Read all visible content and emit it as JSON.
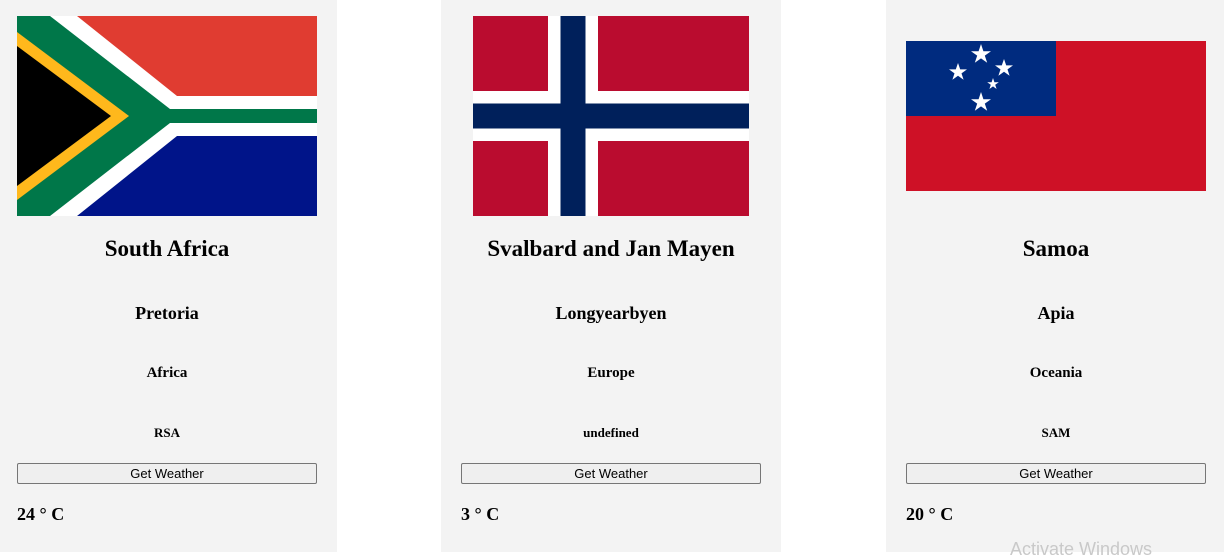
{
  "countries": [
    {
      "name": "South Africa",
      "capital": "Pretoria",
      "region": "Africa",
      "code": "RSA",
      "button_label": "Get Weather",
      "temperature": "24 ° C",
      "flag_icon": "south-africa-flag-icon"
    },
    {
      "name": "Svalbard and Jan Mayen",
      "capital": "Longyearbyen",
      "region": "Europe",
      "code": "undefined",
      "button_label": "Get Weather",
      "temperature": "3 ° C",
      "flag_icon": "norway-flag-icon"
    },
    {
      "name": "Samoa",
      "capital": "Apia",
      "region": "Oceania",
      "code": "SAM",
      "button_label": "Get Weather",
      "temperature": "20 ° C",
      "flag_icon": "samoa-flag-icon"
    }
  ],
  "watermark": "Activate Windows",
  "colors": {
    "card_background": "#f3f3f3",
    "page_background": "#ffffff"
  }
}
